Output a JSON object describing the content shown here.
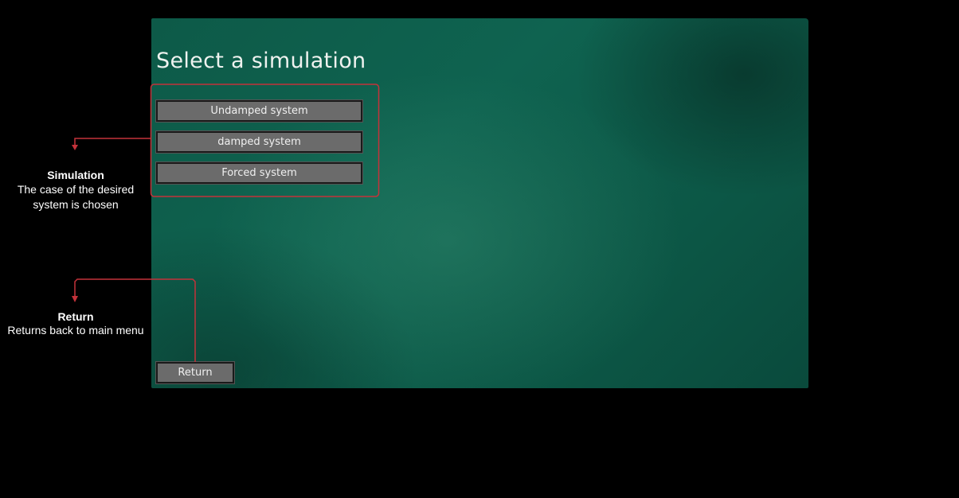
{
  "app": {
    "title": "Select a simulation",
    "simulation_buttons": [
      {
        "label": "Undamped system"
      },
      {
        "label": "damped system"
      },
      {
        "label": "Forced system"
      }
    ],
    "return_label": "Return"
  },
  "annotations": {
    "simulation": {
      "title": "Simulation",
      "description": "The case of the desired system is chosen"
    },
    "return": {
      "title": "Return",
      "description": "Returns back to main menu"
    }
  },
  "colors": {
    "background": "#000000",
    "panel": "#0f6350",
    "button": "#6b6b6b",
    "annotation": "#c4323a"
  }
}
